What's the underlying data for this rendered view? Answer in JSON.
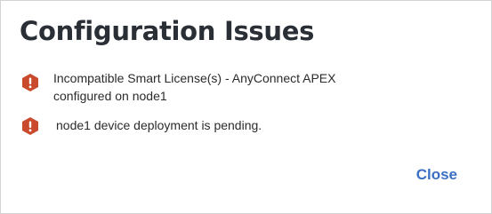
{
  "dialog": {
    "title": "Configuration Issues",
    "issues": [
      {
        "icon": "error-octagon-icon",
        "message": "Incompatible Smart License(s) - AnyConnect APEX configured on node1"
      },
      {
        "icon": "error-octagon-icon",
        "message": "node1 device deployment is pending."
      }
    ],
    "close_label": "Close"
  },
  "colors": {
    "title": "#2a2f36",
    "error_icon": "#c94a2c",
    "link": "#3b6fc2",
    "border": "#d3d3d3"
  }
}
